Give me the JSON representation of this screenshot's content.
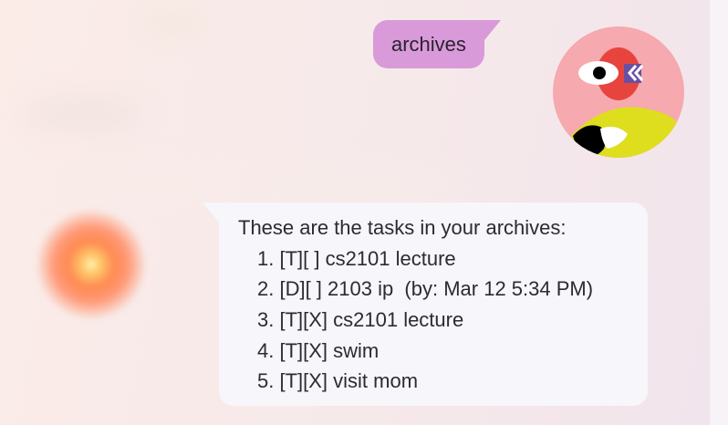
{
  "conversation": {
    "user_message": {
      "text": "archives",
      "avatar": {
        "icon": "bird-face-icon",
        "colors": [
          "#f6a9ae",
          "#e8443e",
          "#dede1e",
          "#000000",
          "#6a4fa3"
        ]
      },
      "bubble_color": "#d89ad8"
    },
    "bot_message": {
      "intro": "These are the tasks in your archives:",
      "tasks": [
        "1. [T][ ] cs2101 lecture",
        "2. [D][ ] 2103 ip  (by: Mar 12 5:34 PM)",
        "3. [T][X] cs2101 lecture",
        "4. [T][X] swim",
        "5. [T][X] visit mom"
      ],
      "avatar": {
        "icon": "glowing-orb-icon",
        "colors": [
          "#fff4b8",
          "#ff8a52"
        ]
      },
      "bubble_color": "#f6f6fb"
    }
  }
}
